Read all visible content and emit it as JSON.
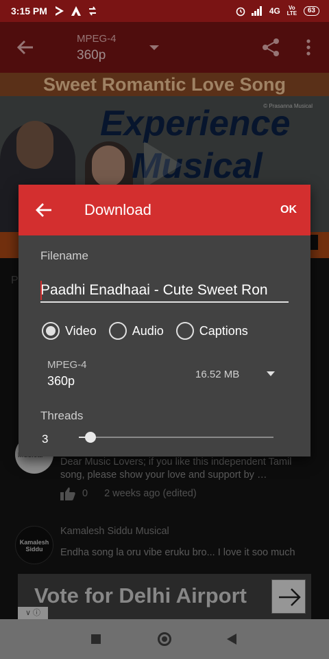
{
  "status_bar": {
    "time": "3:15 PM",
    "left_icons": [
      "screen-record-icon",
      "app-icon",
      "sync-icon"
    ],
    "right": {
      "network": "4G",
      "volte": "Vo LTE",
      "battery": "63"
    }
  },
  "app_bar": {
    "format": "MPEG-4",
    "resolution": "360p"
  },
  "video": {
    "banner_title": "Sweet Romantic Love Song",
    "copyright": "© Prasanna Musical",
    "line1": "Experience",
    "line2": "Musical"
  },
  "comments": {
    "partial_label": "P",
    "comment1": {
      "avatar_text": "Musical",
      "text": "Dear Music Lovers; if you like this independent Tamil song, please show your love and support by …",
      "likes": "0",
      "time": "2 weeks ago (edited)"
    },
    "comment2": {
      "avatar_text": "Kamalesh Siddu",
      "author": "Kamalesh Siddu Musical",
      "text": "Endha song la oru vibe eruku bro... I love it soo much"
    },
    "ad": {
      "text": "Vote for Delhi Airport"
    }
  },
  "dialog": {
    "title": "Download",
    "ok_label": "OK",
    "filename_label": "Filename",
    "filename_value": "Paadhi Enadhaai - Cute Sweet Ron",
    "options": [
      {
        "label": "Video",
        "selected": true
      },
      {
        "label": "Audio",
        "selected": false
      },
      {
        "label": "Captions",
        "selected": false
      }
    ],
    "quality": {
      "format": "MPEG-4",
      "resolution": "360p",
      "size": "16.52 MB"
    },
    "threads_label": "Threads",
    "threads_value": "3",
    "threads_slider_fraction": 0.06
  },
  "colors": {
    "accent": "#d32f2f",
    "appbar_dark": "#7a1414",
    "dialog_bg": "#424242"
  }
}
